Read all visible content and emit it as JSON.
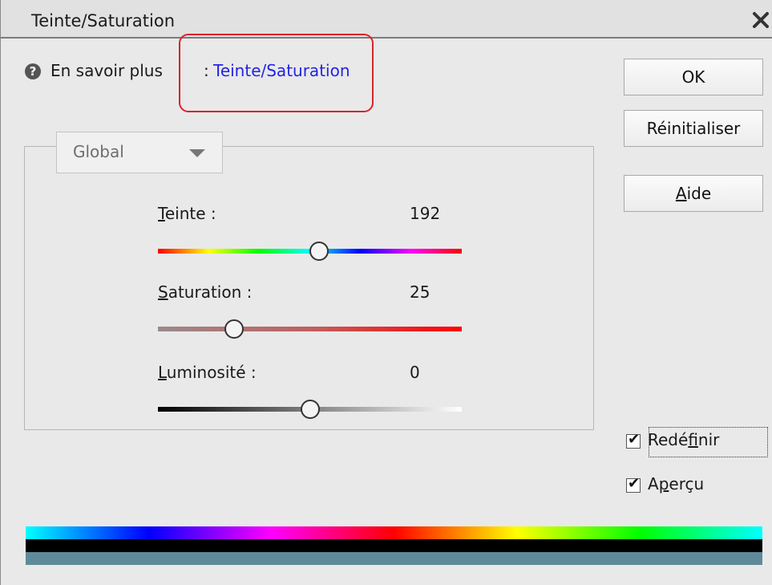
{
  "window": {
    "title": "Teinte/Saturation"
  },
  "help": {
    "prefix": "En savoir plus",
    "separator": ":",
    "link": "Teinte/Saturation"
  },
  "buttons": {
    "ok": "OK",
    "reset": "Réinitialiser",
    "help_first": "A",
    "help_rest": "ide"
  },
  "channel": {
    "selected": "Global"
  },
  "sliders": {
    "hue": {
      "first": "T",
      "rest": "einte :",
      "value": "192",
      "level": 0.53
    },
    "saturation": {
      "first": "S",
      "rest": "aturation :",
      "value": "25",
      "level": 0.25
    },
    "luminosity": {
      "first": "L",
      "rest": "uminosité :",
      "value": "0",
      "level": 0.5
    }
  },
  "checkboxes": {
    "colorize": {
      "pre": "Redé",
      "accel": "f",
      "post": "inir",
      "checked": true
    },
    "preview": {
      "pre": "A",
      "accel": "p",
      "post": "erçu",
      "checked": true
    }
  },
  "colors": {
    "link": "#2323e6",
    "highlight": "#d9232b",
    "output_bar": "#5f8a99"
  }
}
